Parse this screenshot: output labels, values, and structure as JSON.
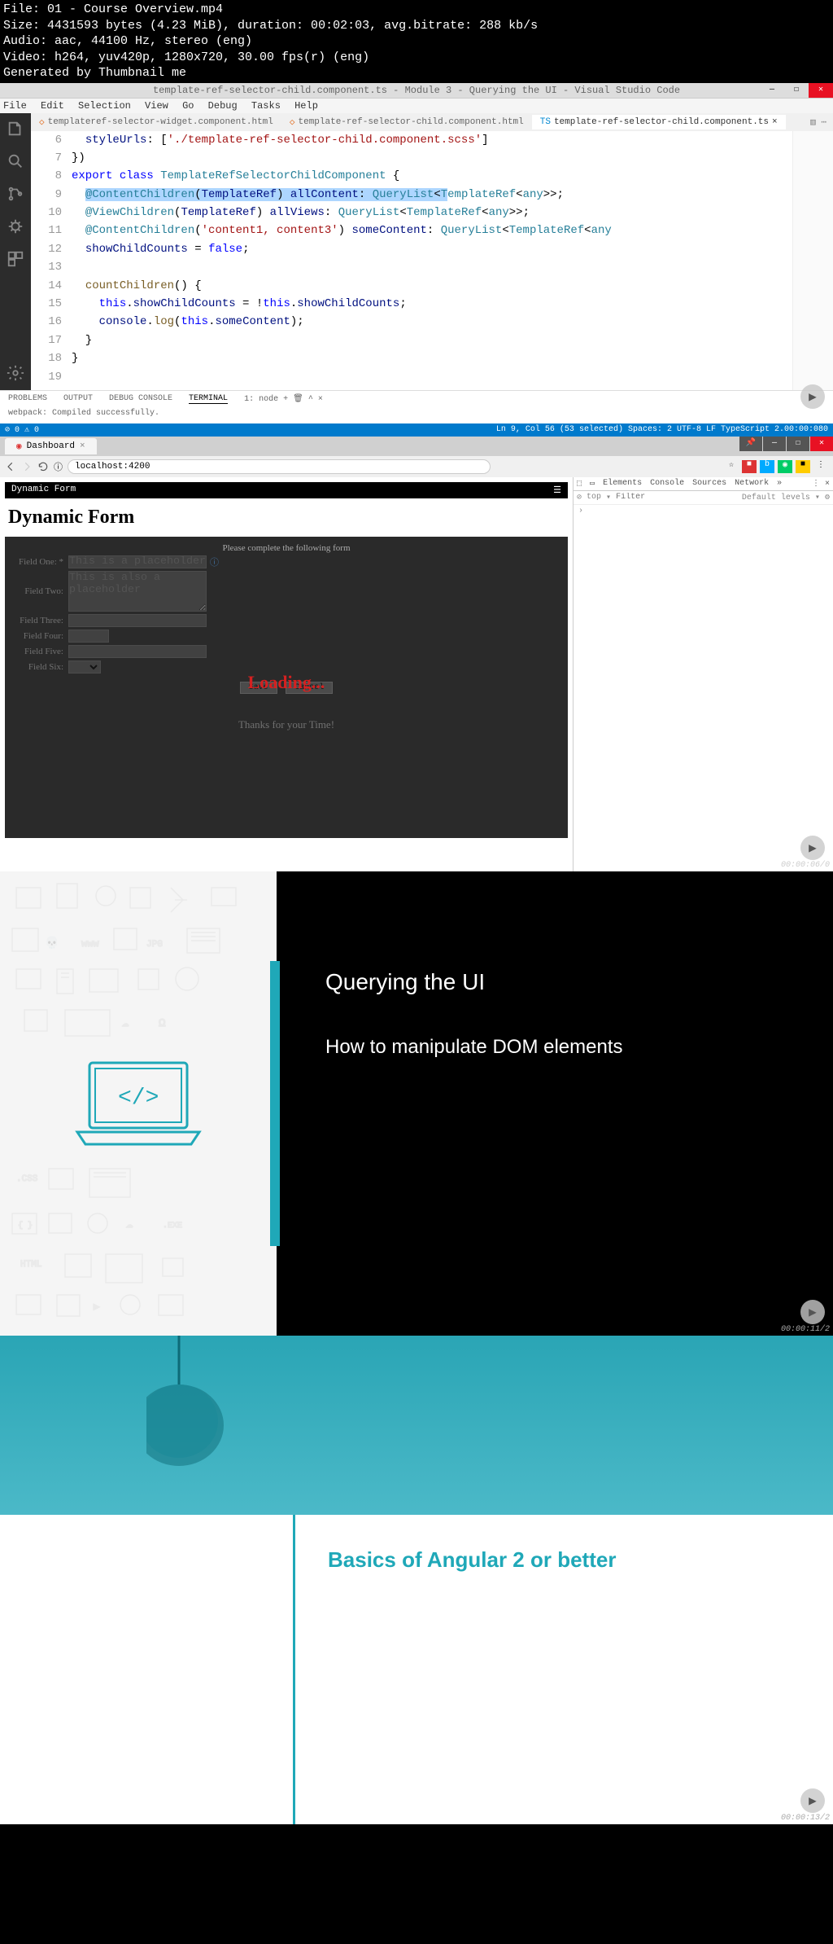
{
  "media": {
    "file": "File: 01 - Course Overview.mp4",
    "size": "Size: 4431593 bytes (4.23 MiB), duration: 00:02:03, avg.bitrate: 288 kb/s",
    "audio": "Audio: aac, 44100 Hz, stereo (eng)",
    "video": "Video: h264, yuv420p, 1280x720, 30.00 fps(r) (eng)",
    "gen": "Generated by Thumbnail me"
  },
  "vscode": {
    "title": "template-ref-selector-child.component.ts - Module 3 - Querying the UI - Visual Studio Code",
    "menu": [
      "File",
      "Edit",
      "Selection",
      "View",
      "Go",
      "Debug",
      "Tasks",
      "Help"
    ],
    "tabs": [
      {
        "label": "templateref-selector-widget.component.html",
        "active": false
      },
      {
        "label": "template-ref-selector-child.component.html",
        "active": false
      },
      {
        "label": "template-ref-selector-child.component.ts",
        "active": true
      }
    ],
    "gutter": [
      "6",
      "7",
      "8",
      "9",
      "10",
      "11",
      "12",
      "13",
      "14",
      "15",
      "16",
      "17",
      "18",
      "19"
    ],
    "panelTabs": [
      "PROBLEMS",
      "OUTPUT",
      "DEBUG CONSOLE",
      "TERMINAL"
    ],
    "terminalSelector": "1: node",
    "terminalOutput": "webpack: Compiled successfully.",
    "statusLeft": "⊘ 0 ⚠ 0",
    "statusRight": "Ln 9, Col 56 (53 selected)   Spaces: 2   UTF-8   LF   TypeScript   2.00:00:080"
  },
  "browser": {
    "tab": "Dashboard",
    "url": "localhost:4200",
    "devtabs": [
      "Elements",
      "Console",
      "Sources",
      "Network",
      "»"
    ],
    "devFilter": "Filter",
    "devLevels": "Default levels ▾",
    "devTop": "top",
    "timestamp": "00:00:06/0"
  },
  "form": {
    "headerTitle": "Dynamic Form",
    "title": "Dynamic Form",
    "subtitle": "Please complete the following form",
    "loading": "Loading...",
    "fields": {
      "one": "Field One: *",
      "onePlaceholder": "This is a placeholder",
      "two": "Field Two:",
      "twoPlaceholder": "This is also a placeholder",
      "three": "Field Three:",
      "four": "Field Four:",
      "five": "Field Five:",
      "six": "Field Six:"
    },
    "buttons": {
      "save": "Save",
      "cancel": "Cancel"
    },
    "thanks": "Thanks for your Time!"
  },
  "slide1": {
    "title": "Querying the UI",
    "subtitle": "How to manipulate DOM elements",
    "timestamp": "00:00:11/2"
  },
  "slide2": {
    "title": "Basics of Angular 2 or better",
    "timestamp": "00:00:13/2"
  }
}
